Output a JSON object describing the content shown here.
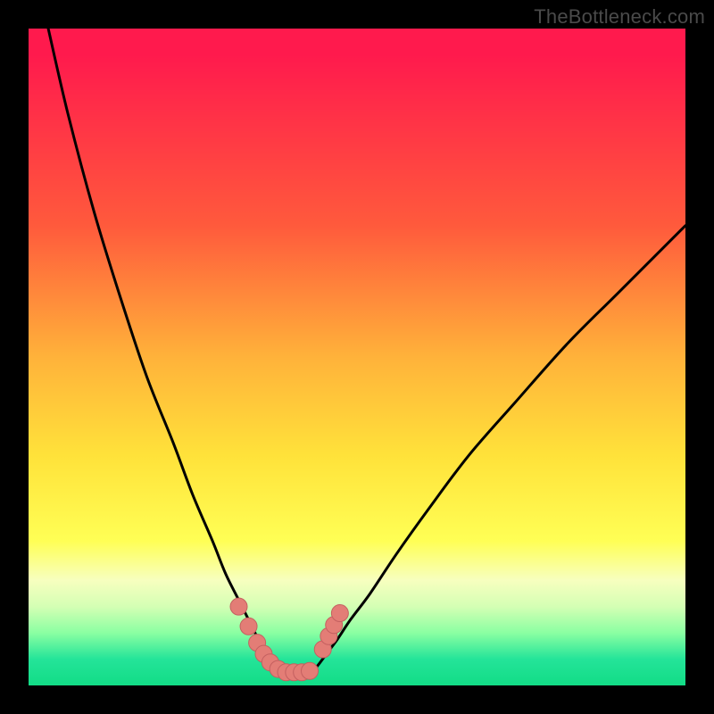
{
  "watermark": {
    "text": "TheBottleneck.com"
  },
  "colors": {
    "frame": "#000000",
    "curve_stroke": "#000000",
    "marker_fill": "#e37d76",
    "marker_stroke": "#c46060"
  },
  "chart_data": {
    "type": "line",
    "title": "",
    "xlabel": "",
    "ylabel": "",
    "xlim": [
      0,
      100
    ],
    "ylim": [
      0,
      100
    ],
    "grid": false,
    "legend": false,
    "note": "no axes, ticks, or text in the figure; values estimated by pixel position",
    "series": [
      {
        "name": "left-branch",
        "x": [
          3,
          6,
          10,
          14,
          18,
          22,
          25,
          28,
          30,
          32,
          34,
          35.5,
          37,
          38.5,
          40
        ],
        "y": [
          100,
          87,
          72,
          59,
          47,
          37,
          29,
          22,
          17,
          13,
          9,
          6,
          4,
          2.5,
          2
        ]
      },
      {
        "name": "right-branch",
        "x": [
          43,
          44,
          45.5,
          47,
          49,
          52,
          56,
          61,
          67,
          74,
          82,
          90,
          100
        ],
        "y": [
          2,
          3,
          5,
          7,
          10,
          14,
          20,
          27,
          35,
          43,
          52,
          60,
          70
        ]
      },
      {
        "name": "valley-floor",
        "x": [
          38.5,
          40,
          41.5,
          43
        ],
        "y": [
          2,
          2,
          2,
          2
        ]
      }
    ],
    "markers": {
      "name": "salmon-dots",
      "points": [
        {
          "x": 32.0,
          "y": 12.0
        },
        {
          "x": 33.5,
          "y": 9.0
        },
        {
          "x": 34.8,
          "y": 6.5
        },
        {
          "x": 35.8,
          "y": 4.8
        },
        {
          "x": 36.8,
          "y": 3.5
        },
        {
          "x": 38.0,
          "y": 2.5
        },
        {
          "x": 39.2,
          "y": 2.0
        },
        {
          "x": 40.4,
          "y": 2.0
        },
        {
          "x": 41.6,
          "y": 2.0
        },
        {
          "x": 42.8,
          "y": 2.2
        },
        {
          "x": 44.8,
          "y": 5.5
        },
        {
          "x": 45.7,
          "y": 7.5
        },
        {
          "x": 46.5,
          "y": 9.2
        },
        {
          "x": 47.4,
          "y": 11.0
        }
      ]
    }
  }
}
